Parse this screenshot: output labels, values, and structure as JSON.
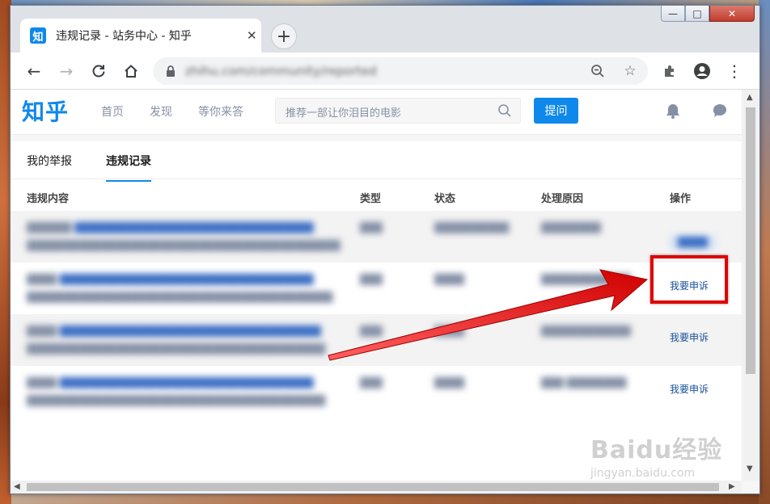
{
  "browser": {
    "tab_title": "违规记录 - 站务中心 - 知乎",
    "tab_icon_text": "知",
    "url": "zhihu.com/community/reported"
  },
  "window_controls": {
    "minimize": "—",
    "maximize": "□",
    "close": "✕"
  },
  "zhihu": {
    "logo": "知乎",
    "nav": [
      "首页",
      "发现",
      "等你来答"
    ],
    "search_placeholder": "推荐一部让你泪目的电影",
    "ask_button": "提问"
  },
  "subtabs": [
    "我的举报",
    "违规记录"
  ],
  "table": {
    "headers": [
      "违规内容",
      "类型",
      "状态",
      "处理原因",
      "操作"
    ],
    "rows": [
      {
        "action": ""
      },
      {
        "action": "我要申诉"
      },
      {
        "action": "我要申诉"
      },
      {
        "action": "我要申诉"
      }
    ]
  },
  "watermark": {
    "main": "Baidu经验",
    "sub": "jingyan.baidu.com"
  },
  "colors": {
    "accent": "#0f88eb",
    "arrow": "#e00000"
  }
}
